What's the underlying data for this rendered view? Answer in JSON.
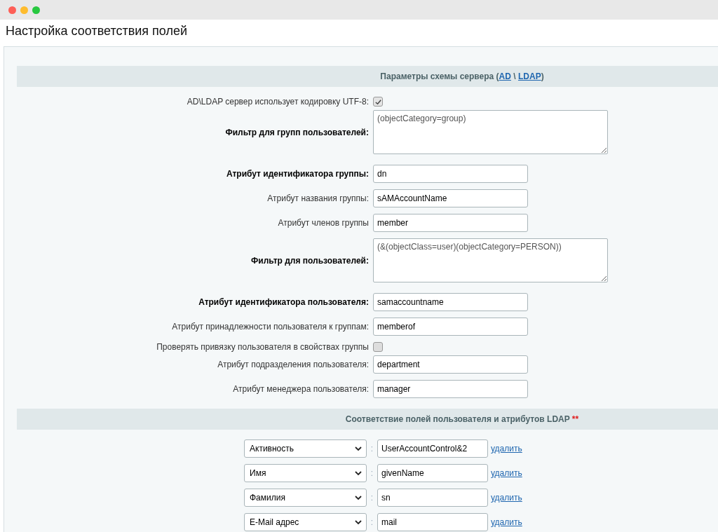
{
  "page_title": "Настройка соответствия полей",
  "schema_section": {
    "text_before": "Параметры схемы сервера (",
    "links": [
      "AD",
      "LDAP"
    ],
    "separator": "\\",
    "text_after": ")"
  },
  "settings": [
    {
      "kind": "checkbox",
      "label": "AD\\LDAP сервер использует кодировку UTF-8:",
      "bold": false,
      "checked": true
    },
    {
      "kind": "textarea",
      "label": "Фильтр для групп пользователей:",
      "bold": true,
      "value": "(objectCategory=group)"
    },
    {
      "kind": "input",
      "label": "Атрибут идентификатора группы:",
      "bold": true,
      "value": "dn"
    },
    {
      "kind": "input",
      "label": "Атрибут названия группы:",
      "bold": false,
      "value": "sAMAccountName"
    },
    {
      "kind": "input",
      "label": "Атрибут членов группы",
      "bold": false,
      "value": "member"
    },
    {
      "kind": "textarea",
      "label": "Фильтр для пользователей:",
      "bold": true,
      "value": "(&(objectClass=user)(objectCategory=PERSON))"
    },
    {
      "kind": "input",
      "label": "Атрибут идентификатора пользователя:",
      "bold": true,
      "value": "samaccountname"
    },
    {
      "kind": "input",
      "label": "Атрибут принадлежности пользователя к группам:",
      "bold": false,
      "value": "memberof"
    },
    {
      "kind": "checkbox",
      "label": "Проверять привязку пользователя в свойствах группы",
      "bold": false,
      "checked": false
    },
    {
      "kind": "input",
      "label": "Атрибут подразделения пользователя:",
      "bold": false,
      "value": "department"
    },
    {
      "kind": "input",
      "label": "Атрибут менеджера пользователя:",
      "bold": false,
      "value": "manager"
    }
  ],
  "mapping_section": {
    "title": "Соответствие полей пользователя и атрибутов LDAP",
    "marker": "**"
  },
  "mappings": [
    {
      "field": "Активность",
      "separator": ":",
      "attribute": "UserAccountControl&2",
      "delete_link": "удалить"
    },
    {
      "field": "Имя",
      "separator": ":",
      "attribute": "givenName",
      "delete_link": "удалить"
    },
    {
      "field": "Фамилия",
      "separator": ":",
      "attribute": "sn",
      "delete_link": "удалить"
    },
    {
      "field": "E-Mail адрес",
      "separator": ":",
      "attribute": "mail",
      "delete_link": "удалить"
    }
  ]
}
